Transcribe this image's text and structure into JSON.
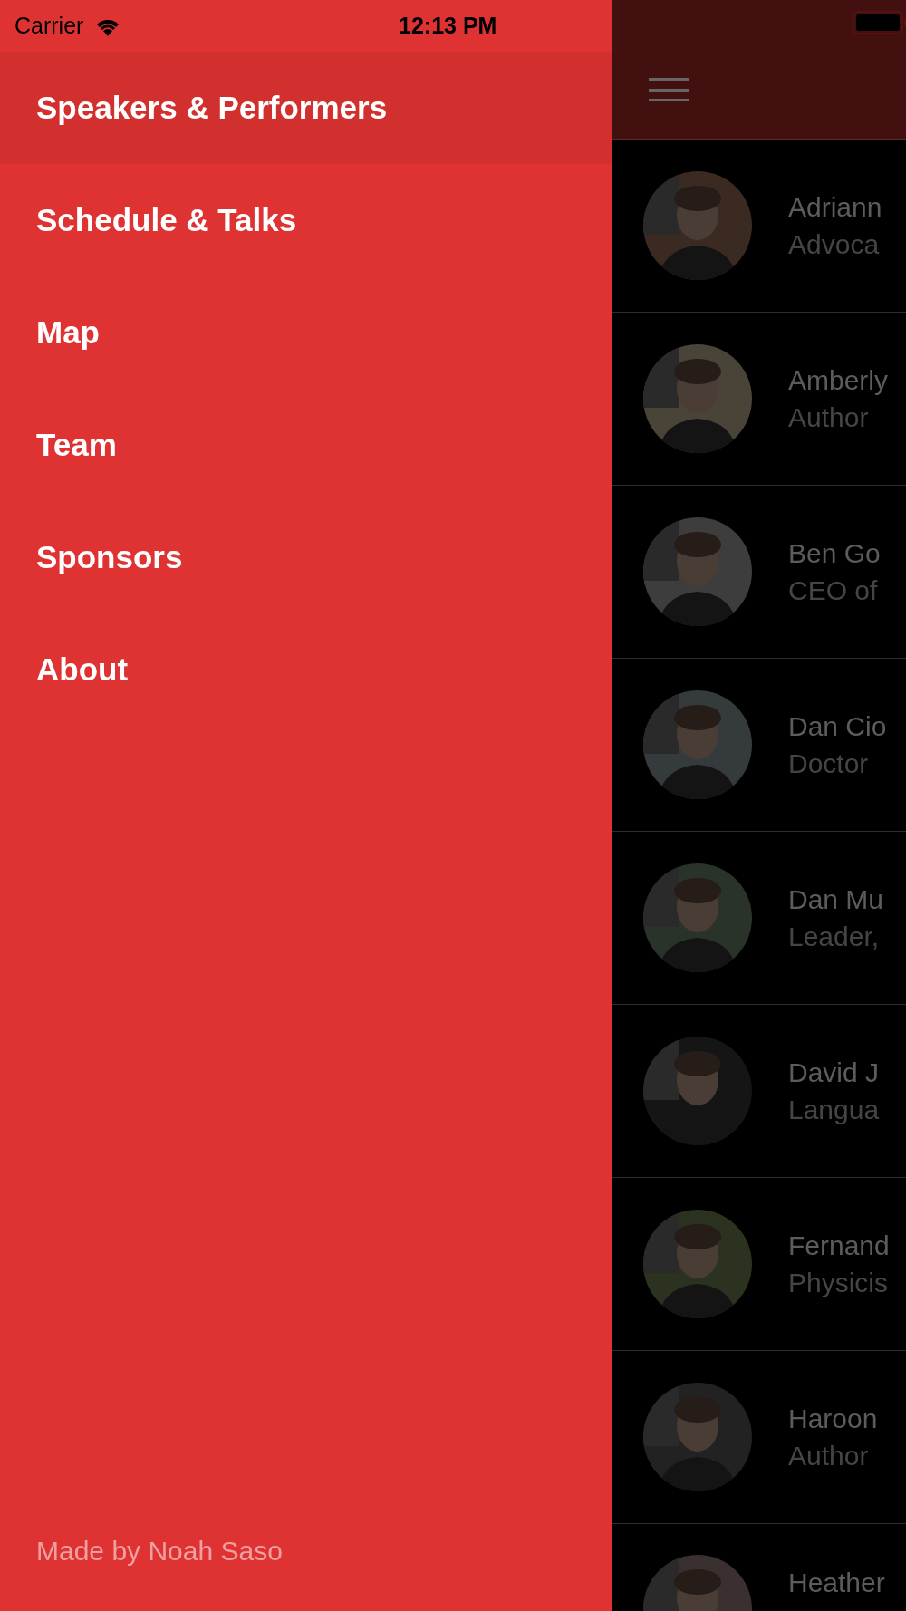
{
  "status_bar": {
    "carrier": "Carrier",
    "time": "12:13 PM"
  },
  "menu": {
    "items": [
      {
        "label": "Speakers & Performers",
        "selected": true
      },
      {
        "label": "Schedule & Talks",
        "selected": false
      },
      {
        "label": "Map",
        "selected": false
      },
      {
        "label": "Team",
        "selected": false
      },
      {
        "label": "Sponsors",
        "selected": false
      },
      {
        "label": "About",
        "selected": false
      }
    ],
    "footer": "Made by Noah Saso"
  },
  "speakers": [
    {
      "name": "Adriann",
      "subtitle": "Advoca"
    },
    {
      "name": "Amberly",
      "subtitle": "Author"
    },
    {
      "name": "Ben Go",
      "subtitle": "CEO of"
    },
    {
      "name": "Dan Cio",
      "subtitle": "Doctor"
    },
    {
      "name": "Dan Mu",
      "subtitle": "Leader,"
    },
    {
      "name": "David J",
      "subtitle": "Langua"
    },
    {
      "name": "Fernand",
      "subtitle": "Physicis"
    },
    {
      "name": "Haroon",
      "subtitle": "Author"
    },
    {
      "name": "Heather"
    }
  ]
}
